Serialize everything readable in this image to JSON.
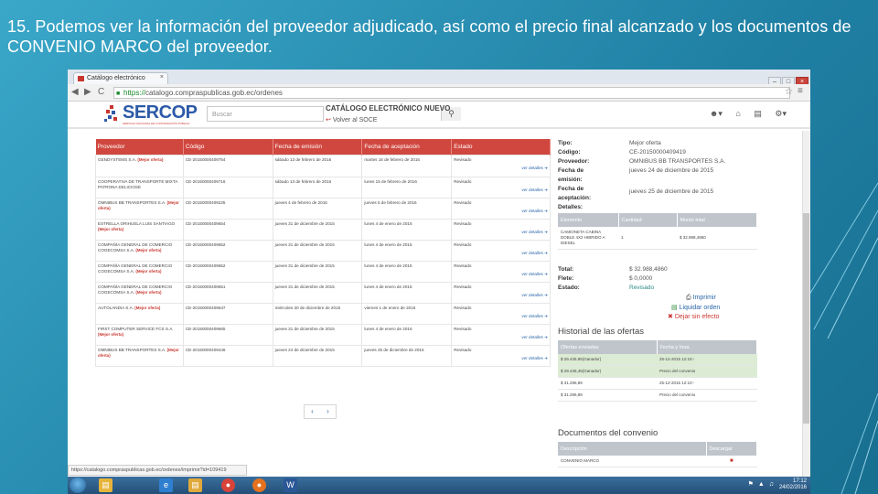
{
  "slide": {
    "caption": "15. Podemos ver la información del proveedor adjudicado, así como el precio final alcanzado y los documentos de CONVENIO MARCO del proveedor."
  },
  "browser": {
    "tab_title": "Catálogo electrónico",
    "tab_close": "×",
    "win_min": "–",
    "win_max": "□",
    "win_close": "×",
    "back": "◀",
    "forward": "▶",
    "reload": "C",
    "url_secure": "https://",
    "url_rest": "catalogo.compraspublicas.gob.ec/ordenes",
    "star": "☆",
    "menu": "≡",
    "status_url": "https://catalogo.compraspublicas.gob.ec/ordenes/imprimir?id=109419"
  },
  "site": {
    "logo": "SERCOP",
    "logo_sub": "SERVICIO NACIONAL DE CONTRATACIÓN PÚBLICA",
    "search_placeholder": "Buscar",
    "search_icon": "magnifier-icon",
    "catalog_title": "CATÁLOGO ELECTRÓNICO NUEVO",
    "back_link": "Volver al SOCE",
    "header_icons": [
      "user-icon",
      "home-icon",
      "cart-icon",
      "settings-icon"
    ]
  },
  "offers": {
    "headers": [
      "Proveedor",
      "Código",
      "Fecha de emisión",
      "Fecha de aceptación",
      "Estado"
    ],
    "detail_label": "ver detalles",
    "rows": [
      {
        "provider": "GENDYSTEMS S.A.",
        "tag": "(Mejor oferta)",
        "code": "CE-20150000409754",
        "issued": "sábado 13 de febrero de 2016",
        "accepted": "martes 16 de febrero de 2016",
        "status": "Revisado"
      },
      {
        "provider": "COOPERATIVA DE TRANSPORTE MIXTA PATRONA DELICIOSE",
        "tag": "",
        "code": "CE-20150000409716",
        "issued": "sábado 13 de febrero de 2016",
        "accepted": "lunes 15 de febrero de 2016",
        "status": "Revisado"
      },
      {
        "provider": "OMNIBUS BB TRANSPORTES S.A.",
        "tag": "(Mejor oferta)",
        "code": "CE-20150000409225",
        "issued": "jueves 4 de febrero de 2016",
        "accepted": "jueves 5 de febrero de 2016",
        "status": "Revisado"
      },
      {
        "provider": "ESTRELLA ORIHUELA LUIS SANTIAGO",
        "tag": "(Mejor oferta)",
        "code": "CE-20150000409654",
        "issued": "jueves 31 de diciembre de 2015",
        "accepted": "lunes 4 de enero de 2016",
        "status": "Revisado"
      },
      {
        "provider": "COMPAÑÍA GENERAL DE COMERCIO COGECOMSA S.A.",
        "tag": "(Mejor oferta)",
        "code": "CE-20150000409652",
        "issued": "jueves 31 de diciembre de 2015",
        "accepted": "lunes 4 de enero de 2016",
        "status": "Revisado"
      },
      {
        "provider": "COMPAÑÍA GENERAL DE COMERCIO COGECOMSA S.A.",
        "tag": "(Mejor oferta)",
        "code": "CE-20150000409652",
        "issued": "jueves 31 de diciembre de 2015",
        "accepted": "lunes 4 de enero de 2016",
        "status": "Revisado"
      },
      {
        "provider": "COMPAÑÍA GENERAL DE COMERCIO COGECOMSA S.A.",
        "tag": "(Mejor oferta)",
        "code": "CE-20150000409651",
        "issued": "jueves 31 de diciembre de 2015",
        "accepted": "lunes 4 de enero de 2016",
        "status": "Revisado"
      },
      {
        "provider": "AUTOLANDIA S.A.",
        "tag": "(Mejor oferta)",
        "code": "CE-20150000409647",
        "issued": "miércoles 30 de diciembre de 2015",
        "accepted": "viernes 1 de enero de 2016",
        "status": "Revisado"
      },
      {
        "provider": "FIRST COMPUTER SERVICE FCS S.A.",
        "tag": "(Mejor oferta)",
        "code": "CE-20150000409665",
        "issued": "jueves 31 de diciembre de 2015",
        "accepted": "lunes 4 de enero de 2016",
        "status": "Revisado"
      },
      {
        "provider": "OMNIBUS BB TRANSPORTES S.A.",
        "tag": "(Mejor oferta)",
        "code": "CE-20150000409446",
        "issued": "jueves 24 de diciembre de 2015",
        "accepted": "jueves 25 de diciembre de 2015",
        "status": "Revisado"
      }
    ],
    "pager_prev": "‹",
    "pager_next": "›"
  },
  "detail": {
    "tipo_k": "Tipo:",
    "tipo_v": "Mejor oferta",
    "codigo_k": "Código:",
    "codigo_v": "CE-20150000409419",
    "prov_k": "Proveedor:",
    "prov_v": "OMNIBUS BB TRANSPORTES S.A.",
    "fe_k1": "Fecha de",
    "fe_k2": "emisión:",
    "fe_v": "jueves 24 de diciembre de 2015",
    "fa_k1": "Fecha de",
    "fa_k2": "aceptación:",
    "fa_v": "jueves 25 de diciembre de 2015",
    "detalles_k": "Detalles:",
    "items_headers": [
      "Elemento",
      "Cantidad",
      "Monto total"
    ],
    "item": {
      "name": "CAMIONETA CABINA DOBLE 4X2 HIBRIDO A DIESEL",
      "qty": "1",
      "total": "$ 32.988,4860"
    },
    "total_k": "Total:",
    "total_v": "$ 32.988,4860",
    "flete_k": "Flete:",
    "flete_v": "$ 0,0000",
    "estado_k": "Estado:",
    "estado_v": "Revisado",
    "print": "Imprimir",
    "liquidate": "Liquidar orden",
    "cancel": "Dejar sin efecto"
  },
  "history": {
    "title": "Historial de las ofertas",
    "headers": [
      "Ofertas enviadas",
      "Fecha y hora"
    ],
    "rows": [
      {
        "offer": "$ 29.435,95(Ganador)",
        "date": "25-12-2015 12:10:-",
        "green": true
      },
      {
        "offer": "$ 29.436,45(Ganador)",
        "date": "Precio del convenio",
        "green": true
      },
      {
        "offer": "$ 31.296,89",
        "date": "25-12-2015 12:10:-",
        "green": false
      },
      {
        "offer": "$ 31.296,89",
        "date": "Precio del convenio",
        "green": false
      }
    ]
  },
  "documents": {
    "title": "Documentos del convenio",
    "headers": [
      "Descripción",
      "Descargar"
    ],
    "rows": [
      {
        "desc": "CONVENIO MARCO",
        "icon": "pdf-icon"
      }
    ]
  },
  "taskbar": {
    "time": "17:12",
    "date": "24/02/2016",
    "apps": [
      "explorer-icon",
      "ie-icon",
      "folder-icon",
      "chrome-icon",
      "firefox-icon",
      "word-icon"
    ]
  },
  "colors": {
    "accent": "#d0473f",
    "brand": "#2d5aa8",
    "slide_bg": "#2a93b5"
  }
}
